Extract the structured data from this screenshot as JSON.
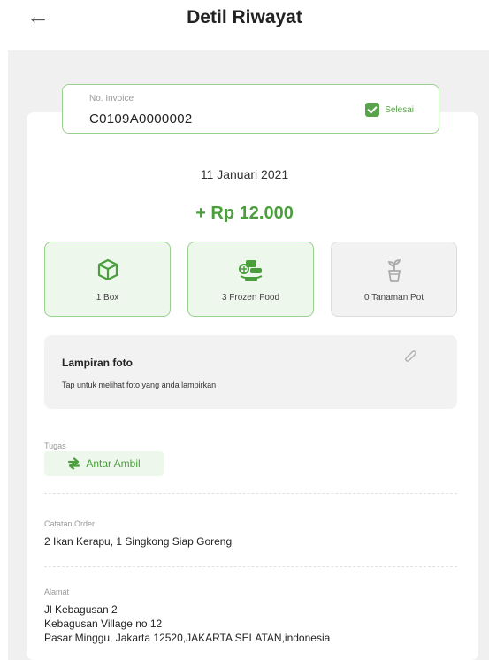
{
  "header": {
    "back_icon": "arrow-left-icon",
    "title": "Detil Riwayat"
  },
  "invoice": {
    "label": "No. Invoice",
    "number": "C0109A0000002",
    "status": "Selesai",
    "status_icon": "checkbox-checked-icon",
    "accent": "#5aa24c"
  },
  "transaction": {
    "date": "11 Januari 2021",
    "amount": "+ Rp 12.000"
  },
  "categories": [
    {
      "label": "1 Box",
      "icon": "box-icon",
      "active": true
    },
    {
      "label": "3 Frozen Food",
      "icon": "frozen-food-icon",
      "active": true
    },
    {
      "label": "0 Tanaman Pot",
      "icon": "potted-plant-icon",
      "active": false
    }
  ],
  "attachment": {
    "title": "Lampiran foto",
    "subtitle": "Tap untuk melihat foto yang anda lampirkan",
    "icon": "paperclip-icon"
  },
  "task": {
    "label": "Tugas",
    "value": "Antar Ambil",
    "icon": "swap-arrows-icon"
  },
  "order_note": {
    "label": "Catatan Order",
    "value": "2 Ikan Kerapu, 1 Singkong Siap Goreng"
  },
  "address": {
    "label": "Alamat",
    "lines": [
      "Jl Kebagusan 2",
      "Kebagusan Village no 12",
      "Pasar Minggu, Jakarta 12520,JAKARTA SELATAN,indonesia"
    ]
  }
}
